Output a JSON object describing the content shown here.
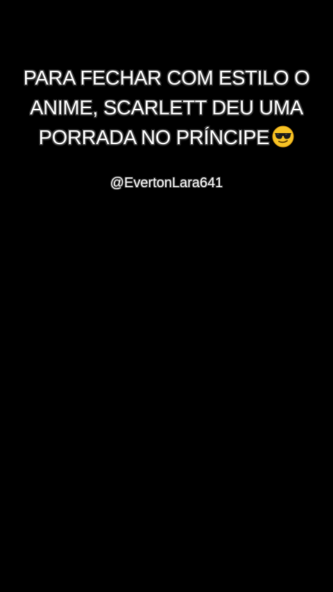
{
  "caption": {
    "lines": [
      "PARA FECHAR COM ESTILO O",
      "ANIME, SCARLETT DEU UMA",
      "PORRADA NO PRÍNCIPE"
    ],
    "emoji": "sunglasses-face-icon"
  },
  "handle": "@EvertonLara641",
  "colors": {
    "background": "#000000",
    "text": "#ffffff",
    "emoji_face": "#f7c325",
    "emoji_glasses": "#1a1a1a"
  }
}
